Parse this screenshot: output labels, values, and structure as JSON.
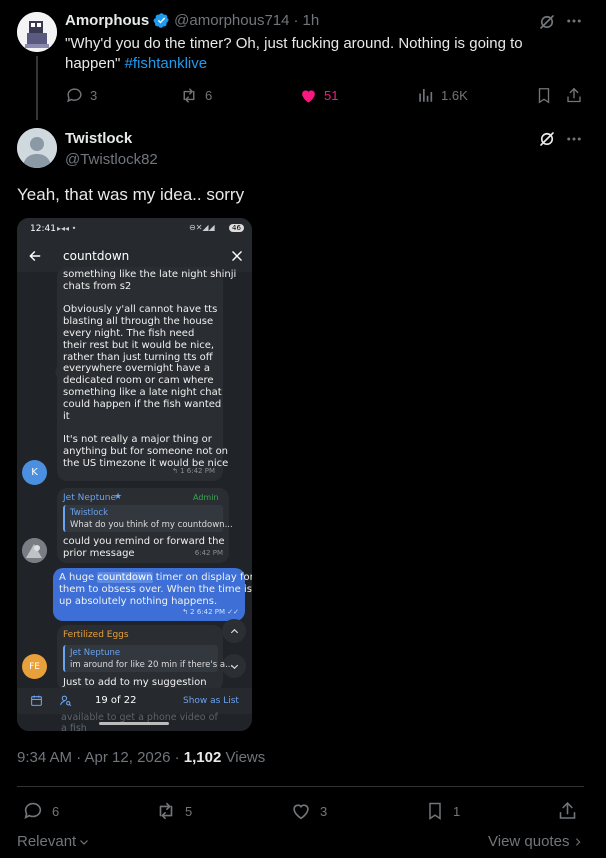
{
  "colors": {
    "verified": "#1d9bf0",
    "link": "#1d9bf0",
    "like_pink": "#f91880",
    "muted": "#71767b",
    "text": "#e7e9ea",
    "bubble_blue": "#3d6fd6",
    "bubble_dark": "#2a2d31",
    "admin_green": "#3aa655",
    "tg_accent": "#6aa3ef",
    "fe_orange": "#e8a03a"
  },
  "top_post": {
    "display_name": "Amorphous",
    "handle": "@amorphous714",
    "separator": "·",
    "age": "1h",
    "text_main": "\"Why'd you do the timer? Oh, just fucking around. Nothing is going to happen\"",
    "hashtag": "#fishtanklive",
    "actions": {
      "replies": "3",
      "reposts": "6",
      "likes": "51",
      "views": "1.6K"
    }
  },
  "main_post": {
    "display_name": "Twistlock",
    "handle": "@Twistlock82",
    "text": "Yeah, that was my idea.. sorry",
    "timestamp": "9:34 AM · Apr 12, 2026 ·",
    "views_count": "1,102",
    "views_label": "Views",
    "actions": {
      "replies": "6",
      "reposts": "5",
      "likes": "3",
      "bookmarks": "1"
    }
  },
  "footer": {
    "sort_label": "Relevant",
    "view_quotes": "View quotes"
  },
  "phone": {
    "status_time": "12:41",
    "battery": "46",
    "search_query": "countdown",
    "msg1_lines": [
      "something like the late night shinji",
      "chats from s2",
      "",
      "Obviously y'all cannot have tts",
      "blasting all through the house",
      "every night. The fish need",
      "their rest but it would be nice,",
      "rather than just turning tts off",
      "everywhere overnight have a",
      "dedicated room or cam where",
      "something like a late night chat",
      "could happen if the fish wanted",
      "it",
      "",
      "It's not really a major thing or",
      "anything but for someone not on",
      "the US timezone it would be nice"
    ],
    "msg1_meta": "↰ 1  6:42 PM",
    "avatar_k": "K",
    "msg2_sender": "Jet Neptune",
    "msg2_badge": "Admin",
    "msg2_reply_name": "Twistlock",
    "msg2_reply_text": "What do you think of my countdown...",
    "msg2_lines": [
      "could you remind or forward the",
      "prior message"
    ],
    "msg2_time": "6:42 PM",
    "msg3_lines_a": "A huge ",
    "msg3_highlight": "countdown",
    "msg3_lines_b": " timer on display for",
    "msg3_line2": "them to obsess over. When the time is",
    "msg3_line3": "up absolutely nothing happens.",
    "msg3_meta": "↰ 2  6:42 PM ✓✓",
    "msg4_sender": "Fertilized Eggs",
    "msg4_reply_name": "Jet Neptune",
    "msg4_reply_text": "im around for like 20 min if there's a...",
    "msg4_text": "Just to add to my suggestion",
    "avatar_fe": "FE",
    "result_counter": "19 of 22",
    "show_as_list": "Show as List",
    "under_text_1": "available to get a phone video of",
    "under_text_2": "a fish"
  }
}
